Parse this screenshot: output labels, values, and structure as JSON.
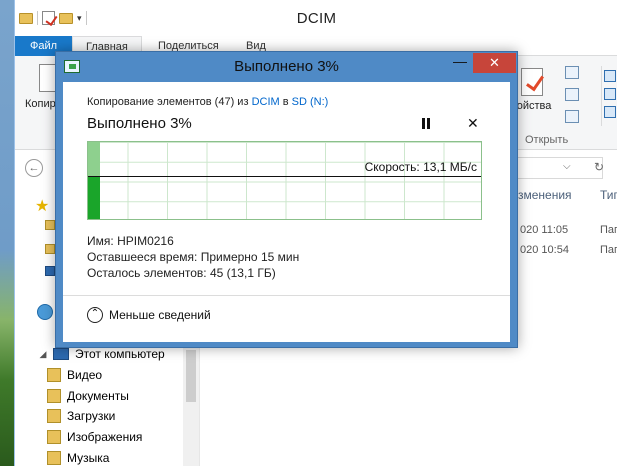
{
  "explorer": {
    "title": "DCIM",
    "tabs": [
      "Файл",
      "Главная",
      "Поделиться",
      "Вид"
    ],
    "ribbon": {
      "copy_label": "Копир",
      "properties_label": "войства",
      "open_group": "Открыть"
    },
    "columns": {
      "modified": "зменения",
      "type": "Тип"
    },
    "rows": [
      {
        "date": "020 11:05",
        "type": "Пап"
      },
      {
        "date": "020 10:54",
        "type": "Пап"
      }
    ],
    "nav": {
      "this_pc": "Этот компьютер",
      "folders": [
        "Видео",
        "Документы",
        "Загрузки",
        "Изображения",
        "Музыка"
      ]
    }
  },
  "dialog": {
    "title": "Выполнено 3%",
    "operation_prefix": "Копирование элементов (47) из",
    "source": "DCIM",
    "to_word": "в",
    "destination": "SD (N:)",
    "progress_heading": "Выполнено 3%",
    "progress_fraction": 0.03,
    "speed": "Скорость: 13,1 МБ/с",
    "name_label": "Имя:",
    "name_value": "HPIM0216",
    "time_label": "Оставшееся время:",
    "time_value": "Примерно 15 мин",
    "items_label": "Осталось элементов:",
    "items_value": "45 (13,1 ГБ)",
    "less_details": "Меньше сведений"
  },
  "colors": {
    "accent": "#1979ca",
    "dialog_frame": "#4f8ac6",
    "close": "#c7453a",
    "graph_fill": "#1aa52a",
    "graph_light": "#8ed08e"
  }
}
